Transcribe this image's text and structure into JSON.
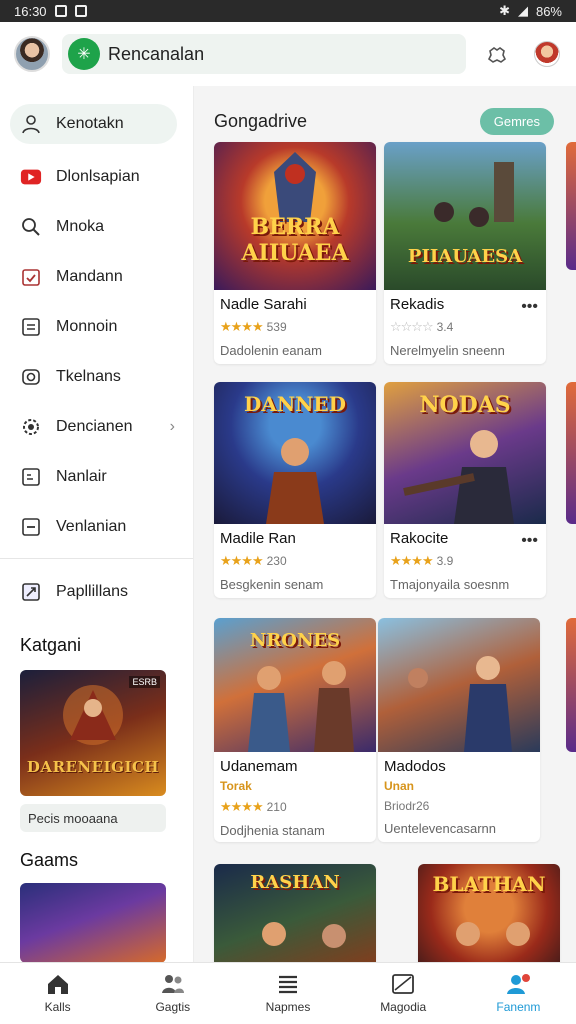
{
  "status_bar": {
    "time": "16:30",
    "battery": "86%"
  },
  "top_bar": {
    "search_text": "Rencanalan"
  },
  "sidebar": {
    "items": [
      {
        "label": "Kenotakn",
        "icon": "person-icon"
      },
      {
        "label": "Dlonlsapian",
        "icon": "video-icon"
      },
      {
        "label": "Mnoka",
        "icon": "search-person-icon"
      },
      {
        "label": "Mandann",
        "icon": "calendar-check-icon"
      },
      {
        "label": "Monnoin",
        "icon": "list-box-icon"
      },
      {
        "label": "Tkelnans",
        "icon": "camera-icon"
      },
      {
        "label": "Dencianen",
        "icon": "gear-icon"
      },
      {
        "label": "Nanlair",
        "icon": "tag-box-icon"
      },
      {
        "label": "Venlanian",
        "icon": "minus-box-icon"
      }
    ],
    "extra_item": {
      "label": "Papllillans",
      "icon": "flag-icon"
    },
    "section1_title": "Katgani",
    "promo": {
      "title": "DARENEIGICH",
      "badge": "ESRB",
      "label": "Pecis mooaana"
    },
    "section2_title": "Gaams"
  },
  "main": {
    "title": "Gongadrive",
    "chip": "Gemres",
    "cards": [
      {
        "art_title": "BERRA AIIUAEA",
        "name": "Nadle Sarahi",
        "rating": "539",
        "desc": "Dadolenin eanam"
      },
      {
        "art_title": "PIIAUAESA",
        "name": "Rekadis",
        "rating": "3.4",
        "desc": "Nerelmyelin sneenn"
      },
      {
        "art_title": "DANNED",
        "name": "Madile Ran",
        "rating": "230",
        "desc": "Besgkenin senam"
      },
      {
        "art_title": "NODAS",
        "name": "Rakocite",
        "rating": "3.9",
        "desc": "Tmajonyaila soesnm"
      },
      {
        "art_title": "NRONES",
        "name": "Udanemam",
        "tag": "Torak",
        "rating": "210",
        "desc": "Dodjhenia stanam"
      },
      {
        "art_title": "",
        "name": "Madodos",
        "tag": "Unan",
        "rating": "Briodr26",
        "desc": "Uentelevencasarnn"
      },
      {
        "art_title": "RASHAN",
        "name": "",
        "rating": "",
        "desc": ""
      },
      {
        "art_title": "BLATHAN",
        "name": "",
        "rating": "",
        "desc": ""
      }
    ]
  },
  "bottom_nav": [
    {
      "label": "Kalls",
      "icon": "home-icon"
    },
    {
      "label": "Gagtis",
      "icon": "people-icon"
    },
    {
      "label": "Napmes",
      "icon": "list-icon"
    },
    {
      "label": "Magodia",
      "icon": "image-icon"
    },
    {
      "label": "Fanenm",
      "icon": "profile-icon"
    }
  ],
  "colors": {
    "accent": "#1ea34a",
    "chip": "#6cbfa7",
    "active_tab": "#1f9ad6",
    "star": "#e8a21b"
  }
}
